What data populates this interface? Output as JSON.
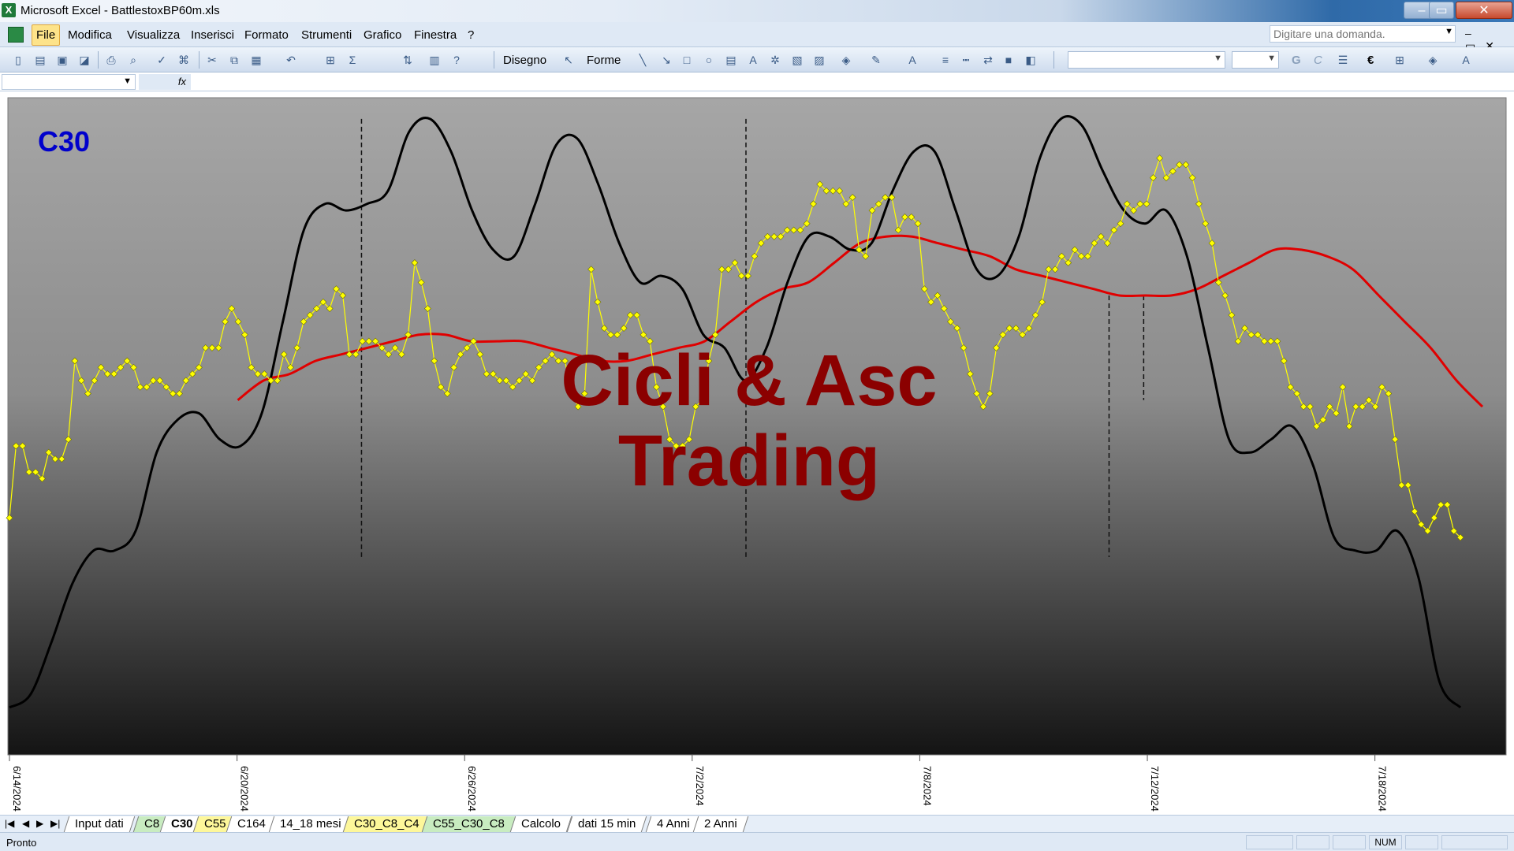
{
  "window": {
    "title": "Microsoft Excel - BattlestoxBP60m.xls",
    "app_icon": "excel-icon"
  },
  "menu": {
    "items": [
      "File",
      "Modifica",
      "Visualizza",
      "Inserisci",
      "Formato",
      "Strumenti",
      "Grafico",
      "Finestra",
      "?"
    ],
    "help_placeholder": "Digitare una domanda."
  },
  "toolbar": {
    "drawing_label": "Disegno",
    "shapes_label": "Forme",
    "bold_label": "G",
    "italic_label": "C",
    "euro_label": "€"
  },
  "chart": {
    "label": "C30",
    "watermark_line1": "Cicli & Asc",
    "watermark_line2": "Trading",
    "colors": {
      "price": "#ffff00",
      "price_marker": "#ffff00",
      "cycle": "#000000",
      "average": "#e00000",
      "watermark": "#8b0000",
      "label": "#0000cc"
    }
  },
  "chart_data": {
    "type": "line",
    "x_tick_labels": [
      "6/14/2024",
      "6/20/2024",
      "6/26/2024",
      "7/2/2024",
      "7/8/2024",
      "7/12/2024",
      "7/18/2024"
    ],
    "series": [
      {
        "key": "price",
        "style": "line-with-diamond-markers",
        "values": [
          0.36,
          0.47,
          0.47,
          0.43,
          0.43,
          0.42,
          0.46,
          0.45,
          0.45,
          0.48,
          0.6,
          0.57,
          0.55,
          0.57,
          0.59,
          0.58,
          0.58,
          0.59,
          0.6,
          0.59,
          0.56,
          0.56,
          0.57,
          0.57,
          0.56,
          0.55,
          0.55,
          0.57,
          0.58,
          0.59,
          0.62,
          0.62,
          0.62,
          0.66,
          0.68,
          0.66,
          0.64,
          0.59,
          0.58,
          0.58,
          0.57,
          0.57,
          0.61,
          0.59,
          0.62,
          0.66,
          0.67,
          0.68,
          0.69,
          0.68,
          0.71,
          0.7,
          0.61,
          0.61,
          0.63,
          0.63,
          0.63,
          0.62,
          0.61,
          0.62,
          0.61,
          0.64,
          0.75,
          0.72,
          0.68,
          0.6,
          0.56,
          0.55,
          0.59,
          0.61,
          0.62,
          0.63,
          0.61,
          0.58,
          0.58,
          0.57,
          0.57,
          0.56,
          0.57,
          0.58,
          0.57,
          0.59,
          0.6,
          0.61,
          0.6,
          0.6,
          0.55,
          0.53,
          0.55,
          0.74,
          0.69,
          0.65,
          0.64,
          0.64,
          0.65,
          0.67,
          0.67,
          0.64,
          0.63,
          0.56,
          0.53,
          0.48,
          0.47,
          0.47,
          0.48,
          0.53,
          0.54,
          0.6,
          0.64,
          0.74,
          0.74,
          0.75,
          0.73,
          0.73,
          0.76,
          0.78,
          0.79,
          0.79,
          0.79,
          0.8,
          0.8,
          0.8,
          0.81,
          0.84,
          0.87,
          0.86,
          0.86,
          0.86,
          0.84,
          0.85,
          0.77,
          0.76,
          0.83,
          0.84,
          0.85,
          0.85,
          0.8,
          0.82,
          0.82,
          0.81,
          0.71,
          0.69,
          0.7,
          0.68,
          0.66,
          0.65,
          0.62,
          0.58,
          0.55,
          0.53,
          0.55,
          0.62,
          0.64,
          0.65,
          0.65,
          0.64,
          0.65,
          0.67,
          0.69,
          0.74,
          0.74,
          0.76,
          0.75,
          0.77,
          0.76,
          0.76,
          0.78,
          0.79,
          0.78,
          0.8,
          0.81,
          0.84,
          0.83,
          0.84,
          0.84,
          0.88,
          0.91,
          0.88,
          0.89,
          0.9,
          0.9,
          0.88,
          0.84,
          0.81,
          0.78,
          0.72,
          0.7,
          0.67,
          0.63,
          0.65,
          0.64,
          0.64,
          0.63,
          0.63,
          0.63,
          0.6,
          0.56,
          0.55,
          0.53,
          0.53,
          0.5,
          0.51,
          0.53,
          0.52,
          0.56,
          0.5,
          0.53,
          0.53,
          0.54,
          0.53,
          0.56,
          0.55,
          0.48,
          0.41,
          0.41,
          0.37,
          0.35,
          0.34,
          0.36,
          0.38,
          0.38,
          0.34,
          0.33
        ]
      },
      {
        "key": "cycle",
        "style": "thick-black-line",
        "values": [
          0.07,
          0.09,
          0.17,
          0.26,
          0.31,
          0.31,
          0.34,
          0.46,
          0.51,
          0.52,
          0.48,
          0.47,
          0.52,
          0.66,
          0.8,
          0.84,
          0.83,
          0.84,
          0.86,
          0.95,
          0.97,
          0.92,
          0.83,
          0.77,
          0.76,
          0.84,
          0.93,
          0.94,
          0.87,
          0.78,
          0.72,
          0.73,
          0.71,
          0.64,
          0.62,
          0.57,
          0.62,
          0.72,
          0.79,
          0.79,
          0.77,
          0.78,
          0.86,
          0.92,
          0.92,
          0.83,
          0.74,
          0.73,
          0.79,
          0.91,
          0.97,
          0.96,
          0.89,
          0.83,
          0.81,
          0.83,
          0.76,
          0.62,
          0.48,
          0.46,
          0.48,
          0.5,
          0.44,
          0.33,
          0.31,
          0.31,
          0.34,
          0.27,
          0.11,
          0.07
        ]
      },
      {
        "key": "average",
        "style": "thick-red-line",
        "values": [
          0.54,
          0.57,
          0.58,
          0.6,
          0.61,
          0.62,
          0.63,
          0.64,
          0.64,
          0.63,
          0.63,
          0.63,
          0.62,
          0.61,
          0.6,
          0.6,
          0.61,
          0.62,
          0.63,
          0.66,
          0.69,
          0.71,
          0.72,
          0.75,
          0.78,
          0.79,
          0.79,
          0.78,
          0.77,
          0.76,
          0.74,
          0.73,
          0.72,
          0.71,
          0.7,
          0.7,
          0.7,
          0.71,
          0.73,
          0.75,
          0.77,
          0.77,
          0.76,
          0.74,
          0.7,
          0.66,
          0.62,
          0.57,
          0.53
        ]
      }
    ],
    "vertical_markers": [
      {
        "x_frac": 0.239,
        "y_top_frac": 0.97,
        "y_bottom_frac": 0.3
      },
      {
        "x_frac": 0.5,
        "y_top_frac": 0.97,
        "y_bottom_frac": 0.3
      },
      {
        "x_frac": 0.7465,
        "y_top_frac": 0.7,
        "y_bottom_frac": 0.3
      },
      {
        "x_frac": 0.77,
        "y_top_frac": 0.7,
        "y_bottom_frac": 0.54
      }
    ],
    "grid": false,
    "legend": "none"
  },
  "sheets": {
    "tabs": [
      {
        "label": "Input dati",
        "color": "white"
      },
      {
        "label": "C8",
        "color": "green"
      },
      {
        "label": "C30",
        "color": "white",
        "active": true
      },
      {
        "label": "C55",
        "color": "yellow"
      },
      {
        "label": "C164",
        "color": "white"
      },
      {
        "label": "14_18 mesi",
        "color": "white"
      },
      {
        "label": "C30_C8_C4",
        "color": "yellow"
      },
      {
        "label": "C55_C30_C8",
        "color": "green"
      },
      {
        "label": "Calcolo",
        "color": "white"
      },
      {
        "label": "dati 15 min",
        "color": "white"
      },
      {
        "label": "4 Anni",
        "color": "white"
      },
      {
        "label": "2 Anni",
        "color": "white"
      }
    ]
  },
  "status": {
    "text": "Pronto",
    "num": "NUM"
  }
}
